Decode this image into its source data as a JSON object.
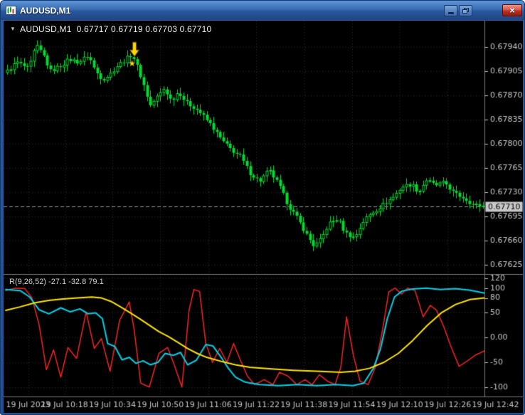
{
  "window": {
    "title": "AUDUSD,M1",
    "buttons": {
      "minimize_label": "minimize",
      "restore_label": "restore",
      "close_label": "close",
      "close_glyph": "×"
    }
  },
  "chart": {
    "dropdown_glyph": "▼",
    "ohlc_label": "AUDUSD,M1  0.67717 0.67719 0.67703 0.67710",
    "indicator_label": "R(9,26,52) -27.1 -32.8 79.1"
  },
  "chart_data": [
    {
      "type": "candlestick",
      "symbol": "AUDUSD",
      "timeframe": "M1",
      "ohlc": {
        "open": 0.67717,
        "high": 0.67719,
        "low": 0.67703,
        "close": 0.6771
      },
      "current_price": {
        "value": 0.6771,
        "label": "0.67710"
      },
      "ylim": [
        0.67612,
        0.67976
      ],
      "y_ticks": [
        "0.67940",
        "0.67905",
        "0.67870",
        "0.67835",
        "0.67800",
        "0.67765",
        "0.67730",
        "0.67695",
        "0.67660",
        "0.67625"
      ],
      "x_ticks": [
        [
          0.047,
          "19 Jul 2023"
        ],
        [
          0.123,
          "19 Jul 10:18"
        ],
        [
          0.223,
          "19 Jul 10:34"
        ],
        [
          0.323,
          "19 Jul 10:50"
        ],
        [
          0.423,
          "19 Jul 11:06"
        ],
        [
          0.523,
          "19 Jul 11:22"
        ],
        [
          0.623,
          "19 Jul 11:38"
        ],
        [
          0.723,
          "19 Jul 11:54"
        ],
        [
          0.823,
          "19 Jul 12:10"
        ],
        [
          0.923,
          "19 Jul 12:26"
        ],
        [
          1.023,
          "19 Jul 12:42"
        ]
      ],
      "num_candles": 144,
      "wick_amp": 9e-05,
      "close_path": [
        [
          0.0,
          0.67905
        ],
        [
          0.02,
          0.67918
        ],
        [
          0.045,
          0.67908
        ],
        [
          0.06,
          0.67942
        ],
        [
          0.075,
          0.6793
        ],
        [
          0.09,
          0.67905
        ],
        [
          0.11,
          0.67912
        ],
        [
          0.13,
          0.67922
        ],
        [
          0.15,
          0.67918
        ],
        [
          0.17,
          0.67928
        ],
        [
          0.185,
          0.67905
        ],
        [
          0.2,
          0.67893
        ],
        [
          0.215,
          0.679
        ],
        [
          0.23,
          0.67912
        ],
        [
          0.245,
          0.6792
        ],
        [
          0.262,
          0.6793
        ],
        [
          0.275,
          0.67908
        ],
        [
          0.29,
          0.67878
        ],
        [
          0.3,
          0.67855
        ],
        [
          0.315,
          0.67868
        ],
        [
          0.33,
          0.6788
        ],
        [
          0.345,
          0.67862
        ],
        [
          0.36,
          0.67876
        ],
        [
          0.375,
          0.6786
        ],
        [
          0.395,
          0.67852
        ],
        [
          0.41,
          0.67842
        ],
        [
          0.43,
          0.67826
        ],
        [
          0.45,
          0.67806
        ],
        [
          0.47,
          0.67792
        ],
        [
          0.49,
          0.67782
        ],
        [
          0.51,
          0.67758
        ],
        [
          0.53,
          0.67746
        ],
        [
          0.55,
          0.67762
        ],
        [
          0.57,
          0.67742
        ],
        [
          0.59,
          0.67712
        ],
        [
          0.61,
          0.67692
        ],
        [
          0.63,
          0.67668
        ],
        [
          0.645,
          0.67652
        ],
        [
          0.66,
          0.67662
        ],
        [
          0.675,
          0.67684
        ],
        [
          0.695,
          0.67692
        ],
        [
          0.71,
          0.67672
        ],
        [
          0.73,
          0.67664
        ],
        [
          0.75,
          0.6769
        ],
        [
          0.77,
          0.67702
        ],
        [
          0.79,
          0.67712
        ],
        [
          0.81,
          0.67722
        ],
        [
          0.83,
          0.67738
        ],
        [
          0.85,
          0.67742
        ],
        [
          0.865,
          0.6773
        ],
        [
          0.88,
          0.67748
        ],
        [
          0.9,
          0.6774
        ],
        [
          0.92,
          0.67744
        ],
        [
          0.94,
          0.67728
        ],
        [
          0.96,
          0.67722
        ],
        [
          0.98,
          0.67712
        ],
        [
          1.0,
          0.6771
        ]
      ],
      "annotations": [
        {
          "type": "arrow-down",
          "f": 0.269,
          "price": 0.67947,
          "color": "#ffd800"
        },
        {
          "type": "star",
          "f": 0.264,
          "price": 0.67916,
          "color": "#ffd800",
          "glyph": "★"
        }
      ],
      "colors": {
        "background": "#000000",
        "grid": "#2e2e2e",
        "axis_text": "#c9c9c9",
        "separator": "#787878",
        "candle": "#00dc32",
        "candle_bull_fill": "#000000",
        "price_line": "#9a9a9a",
        "price_badge_bg": "#c8c8c8",
        "price_badge_text": "#000000"
      }
    },
    {
      "type": "line",
      "label": "R(9,26,52) -27.1 -32.8 79.1",
      "last_values": [
        -27.1,
        -32.8,
        79.1
      ],
      "ylim": [
        -119,
        124
      ],
      "y_ticks": [
        [
          120,
          "120"
        ],
        [
          100,
          "100"
        ],
        [
          80,
          "80"
        ],
        [
          50,
          "50"
        ],
        [
          0,
          "0.00"
        ],
        [
          -50,
          "-50"
        ],
        [
          -100,
          "-100"
        ]
      ],
      "series": [
        {
          "name": "R9",
          "color": "#e82525",
          "points": [
            [
              0,
              95
            ],
            [
              0.02,
              100
            ],
            [
              0.04,
              99
            ],
            [
              0.055,
              80
            ],
            [
              0.07,
              25
            ],
            [
              0.085,
              -65
            ],
            [
              0.1,
              -25
            ],
            [
              0.115,
              -80
            ],
            [
              0.13,
              -20
            ],
            [
              0.148,
              -42
            ],
            [
              0.168,
              52
            ],
            [
              0.185,
              -22
            ],
            [
              0.2,
              -2
            ],
            [
              0.218,
              -68
            ],
            [
              0.238,
              35
            ],
            [
              0.258,
              72
            ],
            [
              0.268,
              18
            ],
            [
              0.282,
              -92
            ],
            [
              0.3,
              -100
            ],
            [
              0.32,
              -32
            ],
            [
              0.338,
              -20
            ],
            [
              0.352,
              -55
            ],
            [
              0.368,
              -100
            ],
            [
              0.383,
              55
            ],
            [
              0.393,
              97
            ],
            [
              0.405,
              93
            ],
            [
              0.418,
              -12
            ],
            [
              0.432,
              -50
            ],
            [
              0.447,
              -22
            ],
            [
              0.462,
              -50
            ],
            [
              0.476,
              -12
            ],
            [
              0.49,
              -45
            ],
            [
              0.505,
              -78
            ],
            [
              0.52,
              -95
            ],
            [
              0.54,
              -85
            ],
            [
              0.558,
              -95
            ],
            [
              0.572,
              -70
            ],
            [
              0.59,
              -78
            ],
            [
              0.608,
              -95
            ],
            [
              0.625,
              -85
            ],
            [
              0.64,
              -95
            ],
            [
              0.655,
              -75
            ],
            [
              0.672,
              -88
            ],
            [
              0.688,
              -95
            ],
            [
              0.7,
              -60
            ],
            [
              0.712,
              42
            ],
            [
              0.726,
              -35
            ],
            [
              0.74,
              -88
            ],
            [
              0.757,
              -95
            ],
            [
              0.772,
              -60
            ],
            [
              0.787,
              15
            ],
            [
              0.8,
              92
            ],
            [
              0.813,
              100
            ],
            [
              0.827,
              88
            ],
            [
              0.84,
              100
            ],
            [
              0.855,
              95
            ],
            [
              0.872,
              42
            ],
            [
              0.887,
              65
            ],
            [
              0.9,
              55
            ],
            [
              0.915,
              22
            ],
            [
              0.93,
              -18
            ],
            [
              0.947,
              -58
            ],
            [
              0.963,
              -48
            ],
            [
              0.98,
              -36
            ],
            [
              1,
              -27
            ]
          ]
        },
        {
          "name": "R26",
          "color": "#00d2e8",
          "points": [
            [
              0,
              97
            ],
            [
              0.03,
              95
            ],
            [
              0.05,
              82
            ],
            [
              0.07,
              56
            ],
            [
              0.09,
              48
            ],
            [
              0.115,
              60
            ],
            [
              0.135,
              52
            ],
            [
              0.155,
              58
            ],
            [
              0.172,
              48
            ],
            [
              0.188,
              50
            ],
            [
              0.202,
              38
            ],
            [
              0.213,
              -12
            ],
            [
              0.228,
              -18
            ],
            [
              0.243,
              -45
            ],
            [
              0.258,
              -40
            ],
            [
              0.272,
              -52
            ],
            [
              0.287,
              -47
            ],
            [
              0.302,
              -55
            ],
            [
              0.318,
              -50
            ],
            [
              0.333,
              -32
            ],
            [
              0.35,
              -36
            ],
            [
              0.365,
              -30
            ],
            [
              0.38,
              -55
            ],
            [
              0.398,
              -46
            ],
            [
              0.418,
              -14
            ],
            [
              0.433,
              -17
            ],
            [
              0.45,
              -40
            ],
            [
              0.465,
              -62
            ],
            [
              0.48,
              -80
            ],
            [
              0.5,
              -90
            ],
            [
              0.53,
              -95
            ],
            [
              0.57,
              -97
            ],
            [
              0.61,
              -95
            ],
            [
              0.65,
              -97
            ],
            [
              0.69,
              -95
            ],
            [
              0.725,
              -97
            ],
            [
              0.748,
              -92
            ],
            [
              0.768,
              -62
            ],
            [
              0.783,
              -22
            ],
            [
              0.797,
              38
            ],
            [
              0.812,
              82
            ],
            [
              0.828,
              94
            ],
            [
              0.85,
              98
            ],
            [
              0.878,
              100
            ],
            [
              0.908,
              97
            ],
            [
              0.938,
              99
            ],
            [
              0.968,
              96
            ],
            [
              1,
              90
            ]
          ]
        },
        {
          "name": "R52",
          "color": "#ffe400",
          "points": [
            [
              0,
              55
            ],
            [
              0.03,
              62
            ],
            [
              0.06,
              70
            ],
            [
              0.09,
              75
            ],
            [
              0.12,
              78
            ],
            [
              0.15,
              80
            ],
            [
              0.18,
              82
            ],
            [
              0.2,
              80
            ],
            [
              0.22,
              73
            ],
            [
              0.24,
              62
            ],
            [
              0.26,
              50
            ],
            [
              0.28,
              38
            ],
            [
              0.3,
              25
            ],
            [
              0.32,
              12
            ],
            [
              0.34,
              2
            ],
            [
              0.36,
              -10
            ],
            [
              0.38,
              -22
            ],
            [
              0.4,
              -32
            ],
            [
              0.42,
              -40
            ],
            [
              0.45,
              -48
            ],
            [
              0.48,
              -55
            ],
            [
              0.51,
              -60
            ],
            [
              0.55,
              -63
            ],
            [
              0.6,
              -66
            ],
            [
              0.65,
              -68
            ],
            [
              0.7,
              -70
            ],
            [
              0.73,
              -68
            ],
            [
              0.76,
              -62
            ],
            [
              0.79,
              -50
            ],
            [
              0.82,
              -32
            ],
            [
              0.85,
              -6
            ],
            [
              0.88,
              24
            ],
            [
              0.91,
              50
            ],
            [
              0.94,
              67
            ],
            [
              0.97,
              77
            ],
            [
              1,
              80
            ]
          ]
        }
      ]
    }
  ]
}
